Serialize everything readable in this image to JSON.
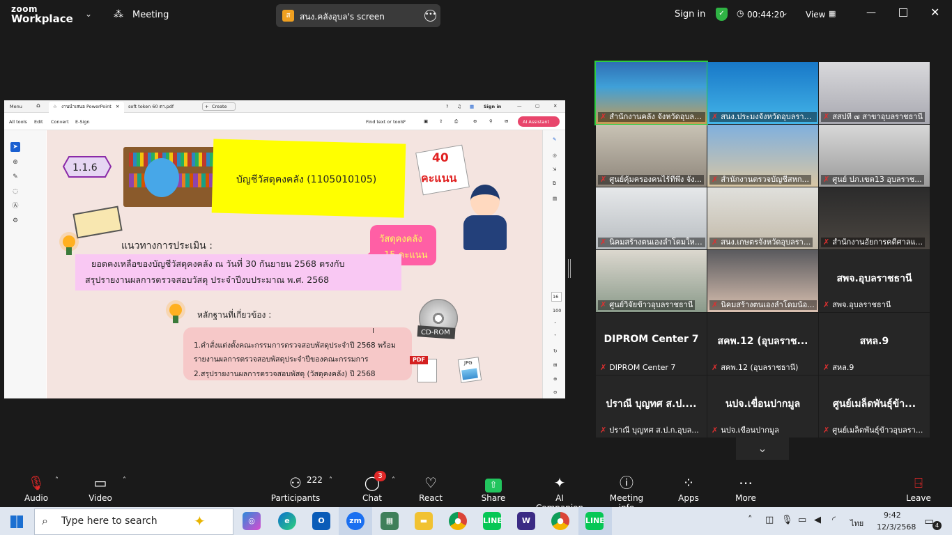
{
  "header": {
    "logo_top": "zoom",
    "logo_bottom": "Workplace",
    "meeting_label": "Meeting",
    "share_initial": "ส",
    "share_title": "สนง.คลังอุบล's screen",
    "sign_in": "Sign in",
    "timer": "00:44:20",
    "view": "View"
  },
  "acrobat": {
    "menu": "Menu",
    "tab1": "งานนำเสนอ PowerPoint",
    "tab2": "soft token 60 ดา.pdf",
    "create": "Create",
    "sign_in": "Sign in",
    "all_tools": "All tools",
    "edit": "Edit",
    "convert": "Convert",
    "esign": "E-Sign",
    "find": "Find text or tools",
    "ai": "AI Assistant",
    "page_num": "16",
    "zoom": "100"
  },
  "slide": {
    "code": "1.1.6",
    "title": "บัญชีวัสดุคงคลัง (1105010105)",
    "score_num": "40",
    "score_word": "คะแนน",
    "bubble_line1": "วัสดุคงคลัง",
    "bubble_line2": "15 คะแนน",
    "section1": "แนวทางการประเมิน :",
    "body_line1": "ยอดคงเหลือของบัญชีวัสดุคงคลัง ณ วันที่ 30 กันยายน 2568 ตรงกับ",
    "body_line2": "สรุปรายงานผลการตรวจสอบวัสดุ ประจำปีงบประมาณ พ.ศ. 2568",
    "section2": "หลักฐานที่เกี่ยวข้อง :",
    "ev_line1": "1.คำสั่งแต่งตั้งคณะกรรมการตรวจสอบพัสดุประจำปี 2568 พร้อม",
    "ev_line2": "รายงานผลการตรวจสอบพัสดุประจำปีของคณะกรรมการ",
    "ev_line3": "2.สรุปรายงานผลการตรวจสอบพัสดุ (วัสดุคงคลัง) ปี 2568",
    "cd_label": "CD-ROM",
    "pdf_label": "PDF",
    "jpg_label": "JPG"
  },
  "tiles": [
    {
      "name": "สำนักงานคลัง จังหวัดอุบลราช...",
      "big": ""
    },
    {
      "name": "สนง.ประมงจังหวัดอุบลราช...",
      "big": ""
    },
    {
      "name": "สสปที ๗ สาขาอุบลราชธานี",
      "big": ""
    },
    {
      "name": "ศูนย์คุ้มครองคนไร้ที่พึ่ง จัง...",
      "big": ""
    },
    {
      "name": "สำนักงานตรวจบัญชีสหก...",
      "big": ""
    },
    {
      "name": "ศูนย์ ปภ.เขต13 อุบลราช...",
      "big": ""
    },
    {
      "name": "นิคมสร้างตนเองลำโดมใหญ...",
      "big": ""
    },
    {
      "name": "สนง.เกษตรจังหวัดอุบลรา...",
      "big": ""
    },
    {
      "name": "สำนักงานอัยการคดีศาลแ...",
      "big": ""
    },
    {
      "name": "ศูนย์วิจัยข้าวอุบลราชธานี",
      "big": ""
    },
    {
      "name": "นิคมสร้างตนเองลำโดมน้อ...",
      "big": ""
    },
    {
      "name": "สพจ.อุบลราชธานี",
      "big": "สพจ.อุบลราชธานี"
    },
    {
      "name": "DIPROM Center 7",
      "big": "DIPROM Center 7"
    },
    {
      "name": "สคพ.12 (อุบลราชธานี)",
      "big": "สคพ.12 (อุบลราช..."
    },
    {
      "name": "สหล.9",
      "big": "สหล.9"
    },
    {
      "name": "ปราณี บุญทศ ส.ป.ก.อุบล...",
      "big": "ปราณี บุญทศ ส.ป...."
    },
    {
      "name": "นปจ.เขื่อนปากมูล",
      "big": "นปจ.เขื่อนปากมูล"
    },
    {
      "name": "ศูนย์เมล็ดพันธุ์ข้าวอุบลรา...",
      "big": "ศูนย์เมล็ดพันธุ์ข้า..."
    }
  ],
  "toolbar": {
    "audio": "Audio",
    "video": "Video",
    "participants": "Participants",
    "participants_count": "222",
    "chat": "Chat",
    "chat_badge": "3",
    "react": "React",
    "share": "Share",
    "ai": "AI Companion",
    "info": "Meeting info",
    "apps": "Apps",
    "more": "More",
    "leave": "Leave"
  },
  "taskbar": {
    "search_placeholder": "Type here to search",
    "lang": "ไทย",
    "time": "9:42",
    "date": "12/3/2568",
    "notif_count": "4"
  },
  "colors": {
    "accent_green": "#00c853",
    "share_green": "#22c55e",
    "leave_red": "#e02828",
    "speaker_border": "#2ecc40"
  }
}
